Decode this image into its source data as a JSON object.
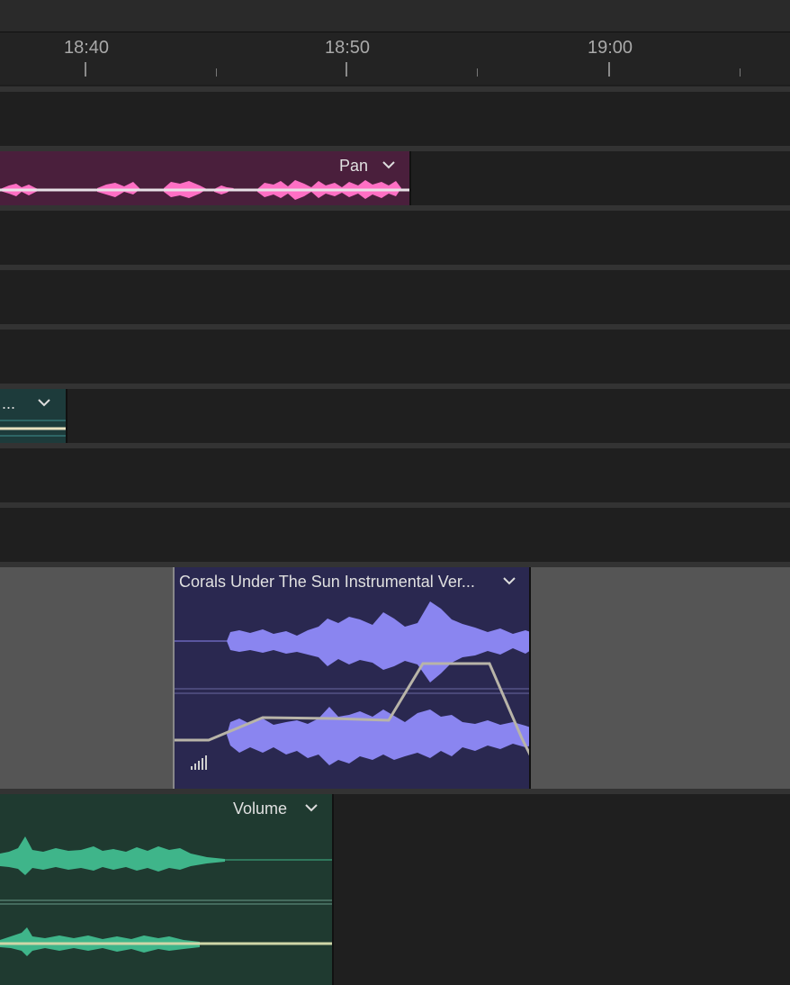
{
  "ruler": {
    "labels": [
      "18:40",
      "18:50",
      "19:00"
    ]
  },
  "clips": {
    "pink": {
      "label": "Pan",
      "color": "#ff6fc4",
      "bg": "#4a1f3c"
    },
    "teal": {
      "label": "...",
      "bg": "#1d3b3b"
    },
    "purple": {
      "label": "Corals Under The Sun   Instrumental Ver...",
      "color": "#8a85f0",
      "bg": "#2a2850"
    },
    "green": {
      "label": "Volume",
      "color": "#3fb58a",
      "bg": "#1f3a30"
    }
  },
  "colors": {
    "selected_track_bg": "#555555",
    "track_bg": "#1f1f1f",
    "separator": "#333333",
    "keyframe_line": "#b8b4a8"
  }
}
